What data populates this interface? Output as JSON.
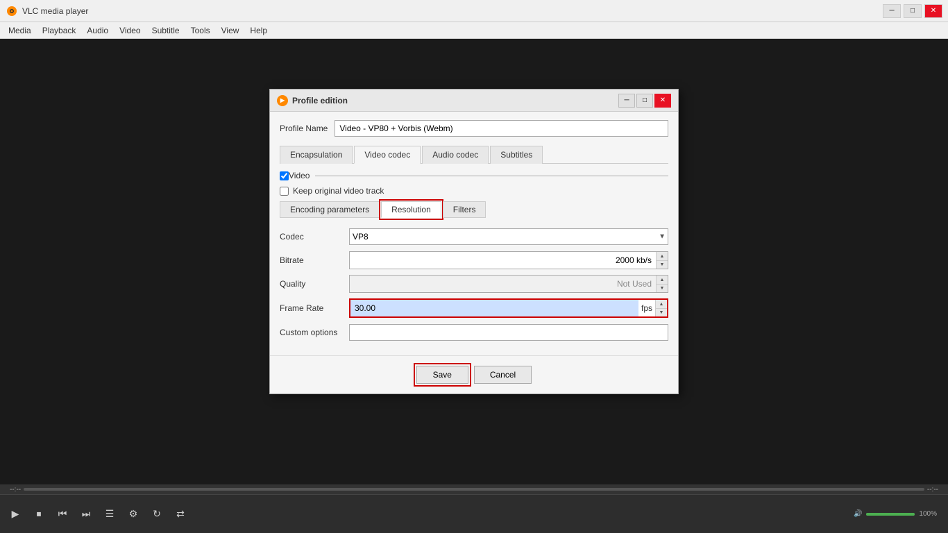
{
  "app": {
    "title": "VLC media player",
    "icon": "vlc"
  },
  "menu": {
    "items": [
      "Media",
      "Playback",
      "Audio",
      "Video",
      "Subtitle",
      "Tools",
      "View",
      "Help"
    ]
  },
  "dialog": {
    "title": "Profile edition",
    "profile_name_label": "Profile Name",
    "profile_name_value": "Video - VP80 + Vorbis (Webm)",
    "tabs": [
      "Encapsulation",
      "Video codec",
      "Audio codec",
      "Subtitles"
    ],
    "active_tab": "Video codec",
    "video_checkbox_label": "Video",
    "keep_original_label": "Keep original video track",
    "enc_tabs": [
      "Encoding parameters",
      "Resolution",
      "Filters"
    ],
    "active_enc_tab": "Resolution",
    "fields": {
      "codec_label": "Codec",
      "codec_value": "VP8",
      "bitrate_label": "Bitrate",
      "bitrate_value": "2000 kb/s",
      "quality_label": "Quality",
      "quality_value": "Not Used",
      "framerate_label": "Frame Rate",
      "framerate_value": "30.00",
      "framerate_unit": "fps",
      "custom_options_label": "Custom options",
      "custom_options_value": ""
    },
    "footer": {
      "save_label": "Save",
      "cancel_label": "Cancel"
    }
  },
  "toolbar": {
    "time_left": "--:--",
    "time_right": "--:--",
    "volume_label": "100%",
    "controls": [
      "prev",
      "stop",
      "play",
      "next",
      "playlist",
      "extended",
      "loop",
      "random"
    ]
  }
}
